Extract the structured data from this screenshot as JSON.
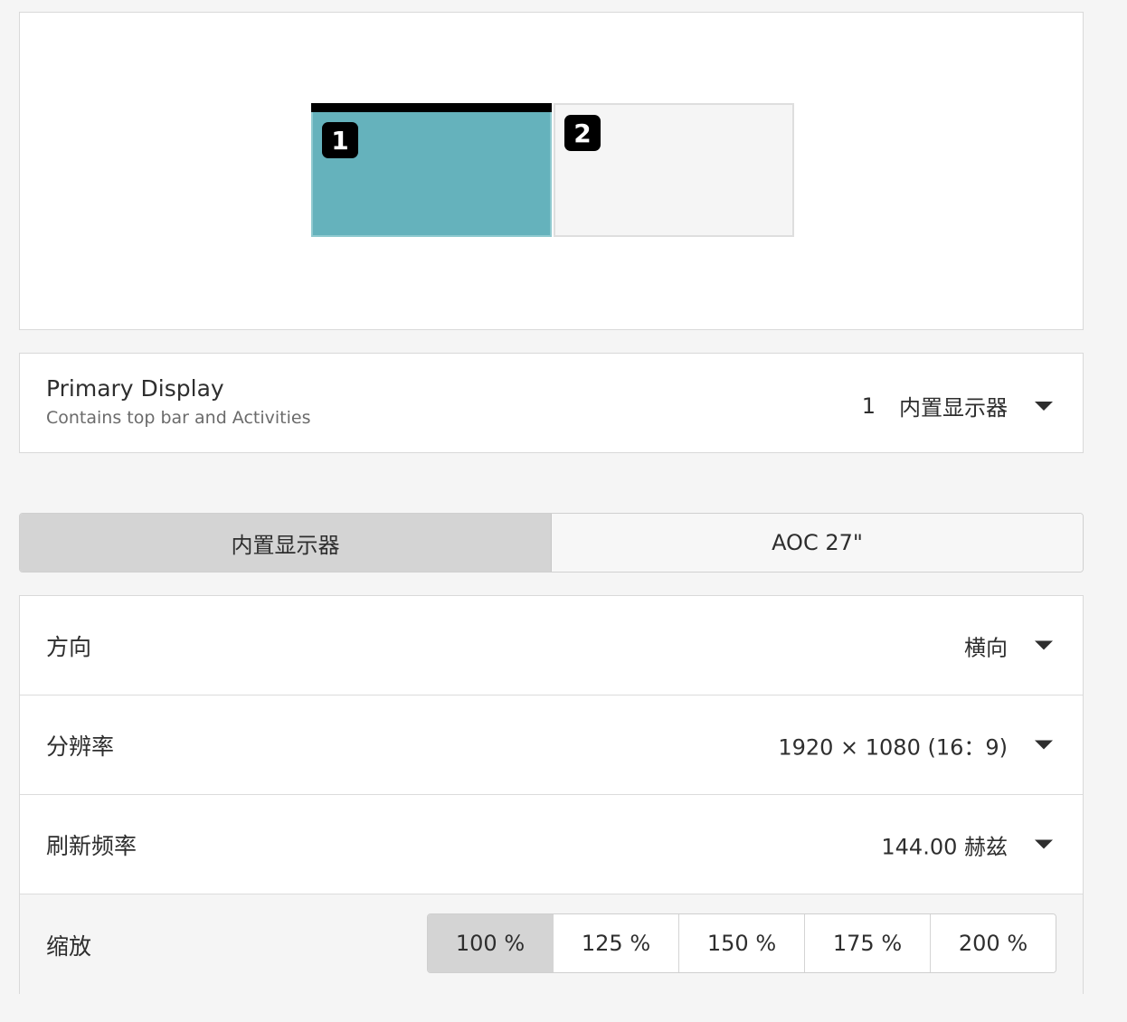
{
  "arrangement": {
    "monitors": [
      {
        "label": "1"
      },
      {
        "label": "2"
      }
    ]
  },
  "primary_display": {
    "title": "Primary Display",
    "subtitle": "Contains top bar and Activities",
    "value_number": "1",
    "value_name": "内置显示器"
  },
  "tabs": [
    {
      "label": "内置显示器",
      "active": true
    },
    {
      "label": "AOC 27\""
    }
  ],
  "settings": {
    "orientation": {
      "label": "方向",
      "value": "横向"
    },
    "resolution": {
      "label": "分辨率",
      "value": "1920 × 1080 (16：9)"
    },
    "refresh_rate": {
      "label": "刷新频率",
      "value": "144.00 赫兹"
    },
    "scale": {
      "label": "缩放",
      "options": [
        "100 %",
        "125 %",
        "150 %",
        "175 %",
        "200 %"
      ],
      "selected": "100 %"
    }
  },
  "colors": {
    "primary_monitor": "#65b2bc",
    "secondary_monitor": "#f5f5f5",
    "active_segment": "#d4d4d4"
  },
  "icons": {
    "dropdown": "caret-down-icon"
  }
}
